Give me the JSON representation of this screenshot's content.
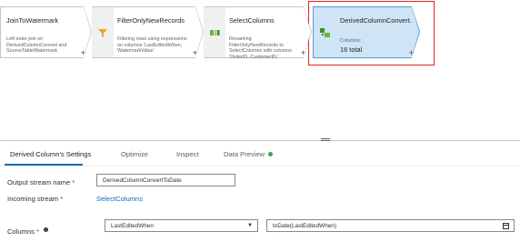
{
  "pipeline": {
    "nodes": [
      {
        "title": "JoinToWatermark",
        "description": "Left outer join on DerivedColumnConvert and SourceTableWatermark"
      },
      {
        "title": "FilterOnlyNewRecords",
        "description": "Filtering rows using expressions on columns 'LastEditedWhen, WatermarkValue'"
      },
      {
        "title": "SelectColumns",
        "description": "Renaming FilterOnlyNewRecords to SelectColumns with columns 'OrderID, CustomerID,'"
      },
      {
        "title": "DerivedColumnConvert...",
        "columns_label": "Columns:",
        "columns_value": "16 total"
      }
    ],
    "add_symbol": "+"
  },
  "tabs": [
    {
      "label": "Derived Column's Settings",
      "active": true
    },
    {
      "label": "Optimize",
      "active": false
    },
    {
      "label": "Inspect",
      "active": false
    },
    {
      "label": "Data Preview",
      "active": false,
      "status_color": "#3fa14c"
    }
  ],
  "form": {
    "output_stream": {
      "label": "Output stream name",
      "required": "*",
      "value": "DerivedColumnConvertToDate"
    },
    "incoming_stream": {
      "label": "Incoming stream",
      "required": "*",
      "value": "SelectColumns"
    },
    "columns": {
      "label": "Columns",
      "required": "*",
      "info": "i",
      "column_value": "LastEditedWhen",
      "expression": "toDate(LastEditedWhen)"
    }
  },
  "colors": {
    "accent": "#0f6cbd",
    "selection_outline": "#e8212c",
    "selected_fill": "#cfe4f5"
  }
}
